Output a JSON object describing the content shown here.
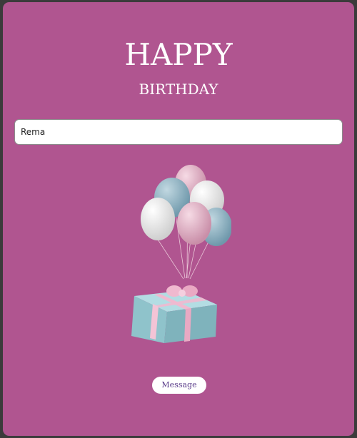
{
  "heading": {
    "line1": "HAPPY",
    "line2": "BIRTHDAY"
  },
  "name_input": {
    "value": "Rema"
  },
  "illustration": {
    "icon": "balloons-gift-icon"
  },
  "message_button": {
    "label": "Message"
  },
  "colors": {
    "background": "#b05590",
    "title": "#ffffff",
    "button_text": "#5a3c8a",
    "balloon_pink": "#e4b8c8",
    "balloon_blue": "#8fb4c4",
    "balloon_white": "#f2f2f2",
    "gift_box": "#8fc3cb",
    "gift_ribbon": "#f0b9cf"
  }
}
